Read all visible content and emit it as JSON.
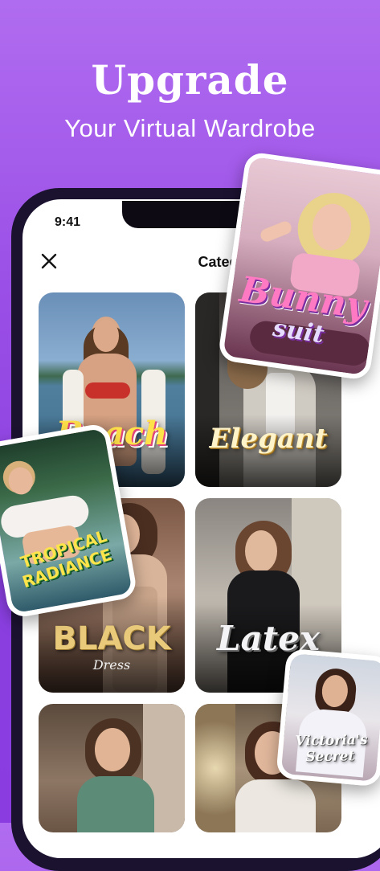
{
  "hero": {
    "title": "Upgrade",
    "subtitle": "Your Virtual Wardrobe"
  },
  "phone": {
    "time": "9:41",
    "header_title": "Category Detai"
  },
  "cards": [
    {
      "label": "Beach"
    },
    {
      "label": "Elegant"
    },
    {
      "label_main": "BLACK",
      "label_sub": "Dress"
    },
    {
      "label": "Latex"
    },
    {
      "label": ""
    },
    {
      "label": ""
    }
  ],
  "floats": {
    "bunny_line1": "Bunny",
    "bunny_line2": "suit",
    "tropical_line1": "TROPICAL",
    "tropical_line2": "RADIANCE",
    "victoria_line1": "Victoria's",
    "victoria_line2": "Secret"
  },
  "icons": {
    "close": "close-icon"
  }
}
